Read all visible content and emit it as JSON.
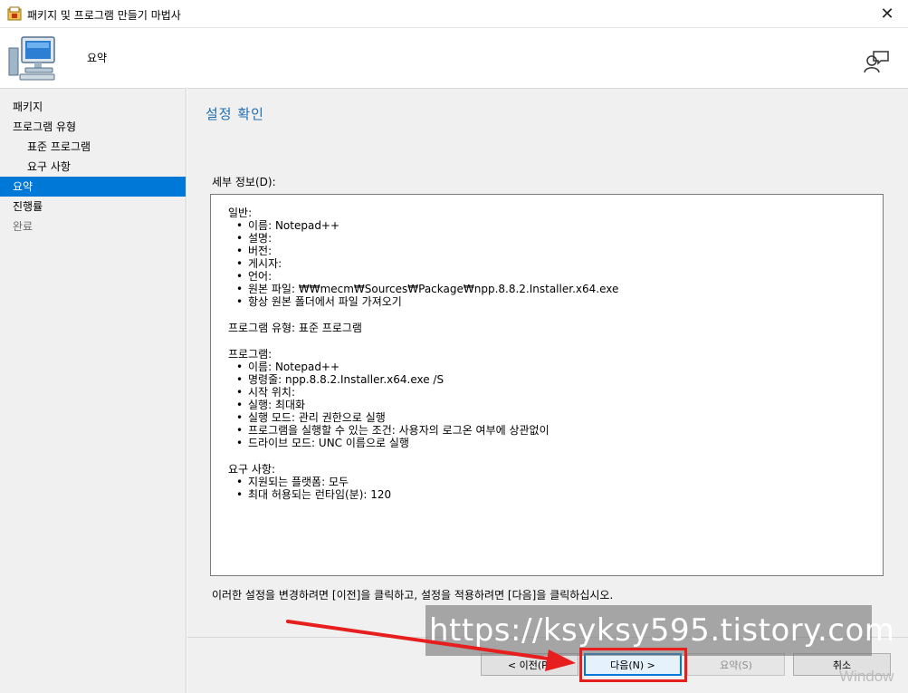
{
  "window": {
    "title": "패키지 및 프로그램 만들기 마법사",
    "close_glyph": "✕"
  },
  "header": {
    "title": "요약"
  },
  "sidebar": {
    "items": [
      {
        "label": "패키지"
      },
      {
        "label": "프로그램 유형"
      },
      {
        "label": "표준 프로그램"
      },
      {
        "label": "요구 사항"
      },
      {
        "label": "요약"
      },
      {
        "label": "진행률"
      },
      {
        "label": "완료"
      }
    ],
    "active_index": 4
  },
  "main": {
    "heading": "설정 확인",
    "details_label": "세부 정보(D):",
    "details": {
      "general": {
        "heading": "일반:",
        "items": [
          "이름: Notepad++",
          "설명:",
          "버전:",
          "게시자:",
          "언어:",
          "원본 파일: ₩₩mecm₩Sources₩Package₩npp.8.8.2.Installer.x64.exe",
          "항상 원본 폴더에서 파일 가져오기"
        ]
      },
      "program_type": "프로그램 유형: 표준 프로그램",
      "program": {
        "heading": "프로그램:",
        "items": [
          "이름: Notepad++",
          "명령줄: npp.8.8.2.Installer.x64.exe /S",
          "시작 위치:",
          "실행: 최대화",
          "실행 모드: 관리 권한으로 실행",
          "프로그램을 실행할 수 있는 조건: 사용자의 로그온 여부에 상관없이",
          "드라이브 모드: UNC 이름으로 실행"
        ]
      },
      "requirements": {
        "heading": "요구 사항:",
        "items": [
          "지원되는 플랫폼: 모두",
          "최대 허용되는 런타임(분): 120"
        ]
      }
    },
    "instructions": "이러한 설정을 변경하려면 [이전]을 클릭하고, 설정을 적용하려면 [다음]을 클릭하십시오."
  },
  "buttons": {
    "prev": "< 이전(P)",
    "next": "다음(N) >",
    "summary": "요약(S)",
    "cancel": "취소"
  },
  "overlay": {
    "watermark": "https://ksyksy595.tistory.com",
    "os_watermark": "Window",
    "arrow_color": "#e61e1e"
  },
  "colors": {
    "accent": "#0078d7",
    "heading": "#1f6fb2",
    "highlight": "#e61e1e"
  }
}
